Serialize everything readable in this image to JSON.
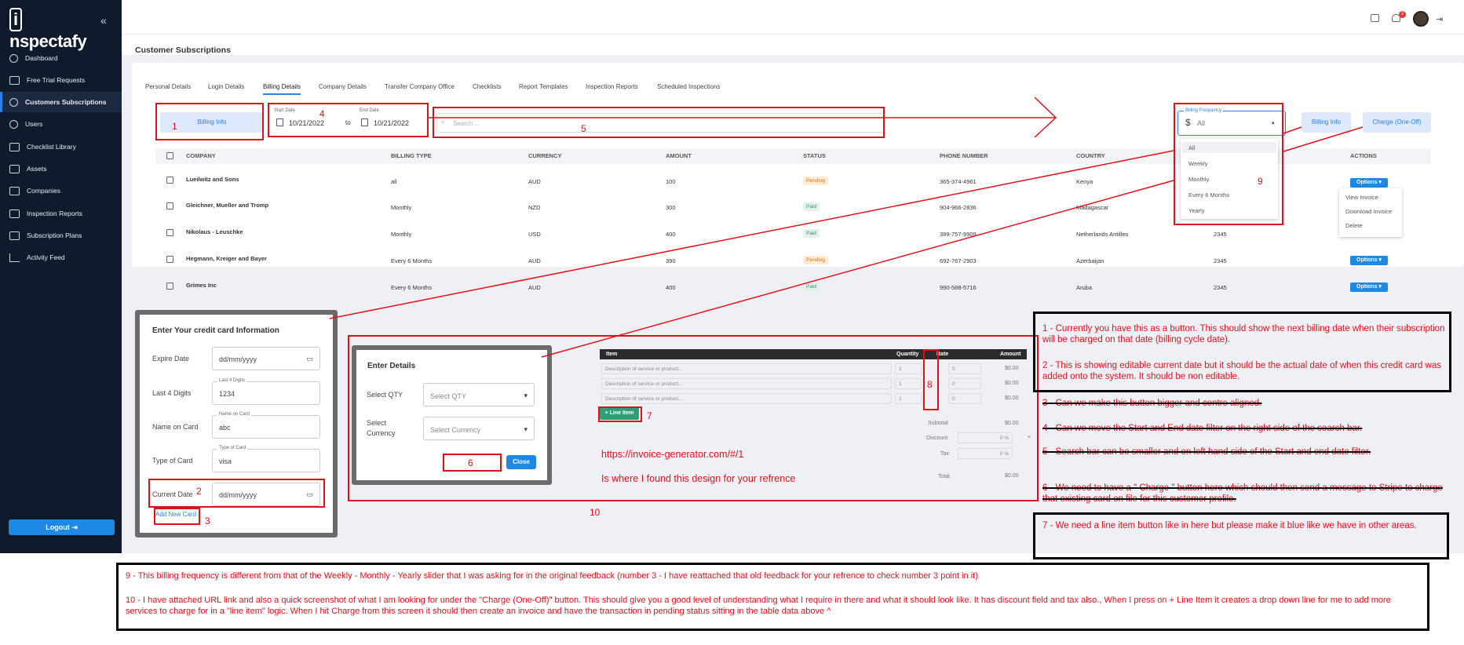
{
  "app": {
    "logo": "Inspectafy",
    "logo_rest": "nspectafy",
    "logo_i": "i"
  },
  "sidebar": {
    "items": [
      {
        "label": "Dashboard",
        "icon": "palette-icon"
      },
      {
        "label": "Free Trial Requests",
        "icon": "tag-icon"
      },
      {
        "label": "Customers Subscriptions",
        "icon": "user-refresh-icon",
        "active": true
      },
      {
        "label": "Users",
        "icon": "user-icon"
      },
      {
        "label": "Checklist Library",
        "icon": "checklist-icon"
      },
      {
        "label": "Assets",
        "icon": "home-icon"
      },
      {
        "label": "Companies",
        "icon": "building-icon"
      },
      {
        "label": "Inspection Reports",
        "icon": "report-icon"
      },
      {
        "label": "Subscription Plans",
        "icon": "id-card-icon"
      },
      {
        "label": "Activity Feed",
        "icon": "chart-icon"
      }
    ],
    "logout": "Logout"
  },
  "topbar": {
    "notification_count": "2"
  },
  "page": {
    "title": "Customer Subscriptions"
  },
  "tabs": [
    "Personal Details",
    "Login Details",
    "Billing Details",
    "Company Details",
    "Transfer Company Office",
    "Checklists",
    "Report Templates",
    "Inspection Reports",
    "Scheduled Inspections"
  ],
  "filters": {
    "billing_info": "Billing Info",
    "start_label": "Start Date",
    "start_value": "10/21/2022",
    "to": "to",
    "end_label": "End Date",
    "end_value": "10/21/2022",
    "search_placeholder": "Search ...",
    "freq_label": "Billing Frequency",
    "freq_value": "All",
    "billing_info2": "Billing Info",
    "charge_button": "Charge (One-Off)"
  },
  "freq_options": [
    "All",
    "Weekly",
    "Monthly",
    "Every 6 Months",
    "Yearly"
  ],
  "table": {
    "headers": [
      "COMPANY",
      "BILLING TYPE",
      "CURRENCY",
      "AMOUNT",
      "STATUS",
      "PHONE NUMBER",
      "COUNTRY",
      "ACTIONS"
    ],
    "rows": [
      {
        "company": "Lueilwitz and Sons",
        "type": "all",
        "currency": "AUD",
        "amount": "100",
        "status": "Pending",
        "phone": "365-374-4961",
        "country": "Kenya",
        "extra": ""
      },
      {
        "company": "Gleichner, Mueller and Tromp",
        "type": "Monthly",
        "currency": "NZD",
        "amount": "300",
        "status": "Paid",
        "phone": "904-966-2836",
        "country": "Madagascar",
        "extra": ""
      },
      {
        "company": "Nikolaus - Leuschke",
        "type": "Monthly",
        "currency": "USD",
        "amount": "400",
        "status": "Paid",
        "phone": "399-757-9909",
        "country": "Netherlands Antilles",
        "extra": "2345"
      },
      {
        "company": "Hegmann, Kreiger and Bayer",
        "type": "Every 6 Months",
        "currency": "AUD",
        "amount": "390",
        "status": "Pending",
        "phone": "692-767-2903",
        "country": "Azerbaijan",
        "extra": "2345"
      },
      {
        "company": "Grimes Inc",
        "type": "Every 6 Months",
        "currency": "AUD",
        "amount": "400",
        "status": "Paid",
        "phone": "990-588-5716",
        "country": "Aruba",
        "extra": "2345"
      }
    ],
    "options_label": "Options",
    "action_menu": [
      "View Invoice",
      "Download Invoice",
      "Delete"
    ]
  },
  "cc_panel": {
    "title": "Enter Your credit card Information",
    "expire_label": "Expire Date",
    "expire_value": "dd/mm/yyyy",
    "last4_label": "Last 4 Digits",
    "last4_small": "Last 4 Digits",
    "last4_value": "1234",
    "name_label": "Name on Card",
    "name_small": "Name on Card",
    "name_value": "abc",
    "type_label": "Type of Card",
    "type_small": "Type of Card",
    "type_value": "visa",
    "current_label": "Current Date",
    "current_value": "dd/mm/yyyy",
    "add_card": "Add New Card"
  },
  "details_panel": {
    "title": "Enter Details",
    "qty_label": "Select QTY",
    "qty_placeholder": "Select QTY",
    "currency_label_1": "Select",
    "currency_label_2": "Currency",
    "currency_placeholder": "Select Currency",
    "close": "Close"
  },
  "invoice": {
    "headers": [
      "Item",
      "Quantity",
      "Rate",
      "Amount"
    ],
    "rows": [
      {
        "desc": "Description of service or product...",
        "qty": "1",
        "rate": "0",
        "amount": "$0.00"
      },
      {
        "desc": "Description of service or product...",
        "qty": "1",
        "rate": "0",
        "amount": "$0.00"
      },
      {
        "desc": "Description of service or product...",
        "qty": "1",
        "rate": "0",
        "amount": "$0.00"
      }
    ],
    "line_item": "+ Line Item",
    "subtotal_label": "Subtotal",
    "subtotal": "$0.00",
    "discount_label": "Discount",
    "discount": "0 %",
    "tax_label": "Tax",
    "tax": "0 %",
    "total_label": "Total",
    "total": "$0.00"
  },
  "annotations": {
    "n1": "1",
    "n2": "2",
    "n3": "3",
    "n4": "4",
    "n5": "5",
    "n6": "6",
    "n7": "7",
    "n8": "8",
    "n9": "9",
    "n10": "10",
    "url": "https://invoice-generator.com/#/1",
    "url_note": "Is where I found this design for your refrence",
    "note1": "1 - Currently you have this as a button. This should show the next billing date when their subscription will be charged on that date (billing cycle date).",
    "note2": "2 - This is showing editable current date but it should be the actual date of when this credit card was added onto the system. It should be non editable.",
    "note3": "3 - Can we make this button bigger and centre aligned.",
    "note4": "4 - Can we move the Start and End date filter on the right side of the search bar.",
    "note5": "5 - Search bar can be smaller and on left hand side of the Start and end date filter.",
    "note6": "6 - We need to have a \" Charge \" button here which should then send a message to Stripe to charge that existing card on file for this customer profile.",
    "note7": "7 - We need a line item button like in here but please make it blue like we have in other areas.",
    "note9": "9 - This billing frequency is different from that of the Weekly - Monthly - Yearly slider that I was asking for in the original feedback (number 3 -  I have reattached that old feedback for your refrence to check number 3 point in it)",
    "note10": "10 - I have attached  URL link and also a quick screenshot of what I am looking for under the \"Charge (One-Off)\" button. This should give you a good level of understanding what I require in there and what it should look like. It has discount field and tax also., When I press on + Line Item it creates a drop down line for me to add more services to charge for in a \"line item\" logic. When I hit Charge from this screen it should then create an invoice and have the transaction in pending status sitting in the table data above ^"
  }
}
